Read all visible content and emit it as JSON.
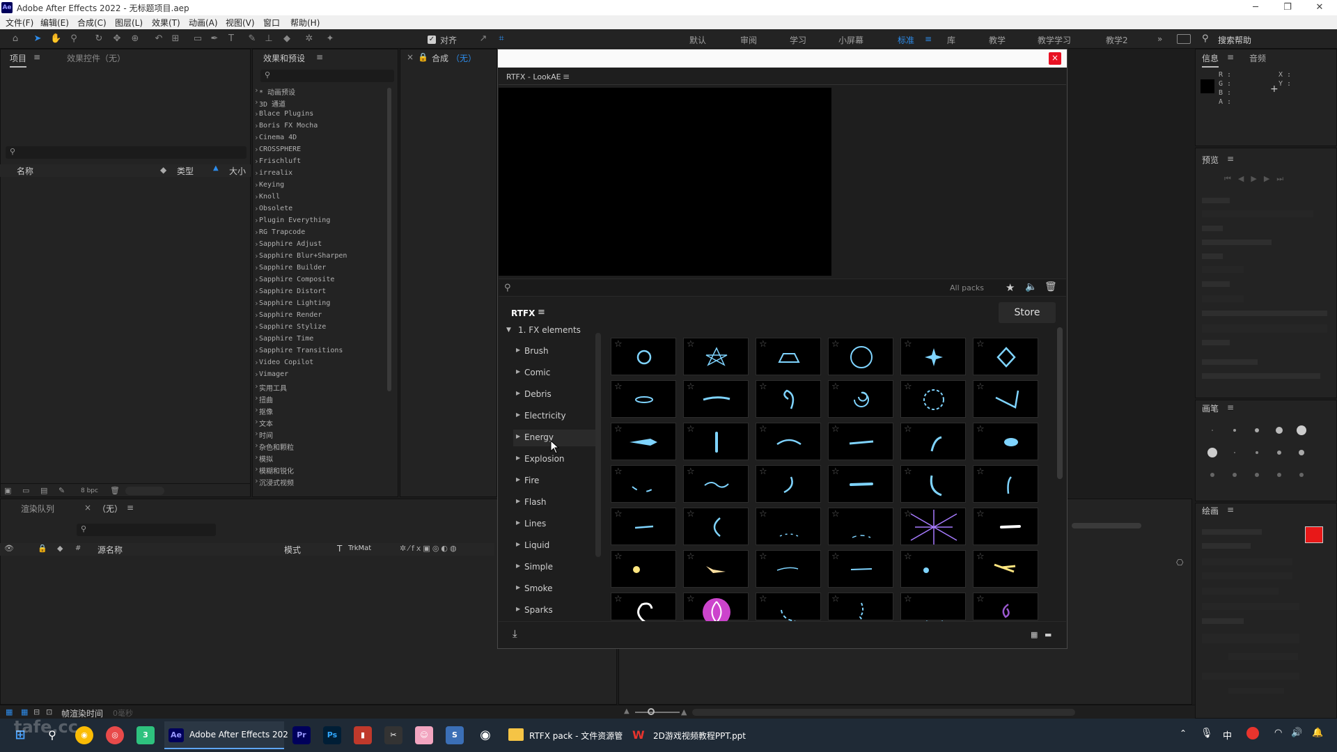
{
  "app": {
    "title": "Adobe After Effects 2022 - 无标题项目.aep",
    "logo": "Ae"
  },
  "menu": [
    "文件(F)",
    "编辑(E)",
    "合成(C)",
    "图层(L)",
    "效果(T)",
    "动画(A)",
    "视图(V)",
    "窗口",
    "帮助(H)"
  ],
  "toolbar": {
    "align_label": "对齐",
    "workspaces": [
      "默认",
      "审阅",
      "学习",
      "小屏幕",
      "标准",
      "库",
      "教学",
      "教学学习",
      "教学2"
    ],
    "active_workspace": "标准",
    "search_help": "搜索帮助"
  },
  "project_panel": {
    "tab_project": "项目",
    "tab_effect_controls": "效果控件（无）",
    "col_name": "名称",
    "col_type": "类型",
    "col_size": "大小",
    "bpc": "8 bpc"
  },
  "effects_panel": {
    "title": "效果和预设",
    "items": [
      "* 动画预设",
      "3D 通道",
      "Blace Plugins",
      "Boris FX Mocha",
      "Cinema 4D",
      "CROSSPHERE",
      "Frischluft",
      "irrealix",
      "Keying",
      "Knoll",
      "Obsolete",
      "Plugin Everything",
      "RG Trapcode",
      "Sapphire Adjust",
      "Sapphire Blur+Sharpen",
      "Sapphire Builder",
      "Sapphire Composite",
      "Sapphire Distort",
      "Sapphire Lighting",
      "Sapphire Render",
      "Sapphire Stylize",
      "Sapphire Time",
      "Sapphire Transitions",
      "Video Copilot",
      "Vimager",
      "实用工具",
      "扭曲",
      "抠像",
      "文本",
      "时间",
      "杂色和颗粒",
      "模拟",
      "模糊和锐化",
      "沉浸式视频"
    ]
  },
  "comp_panel": {
    "tab": "合成",
    "tab_value": "（无）"
  },
  "timeline": {
    "tab_render_queue": "渲染队列",
    "tab_comp": "（无）",
    "col_source": "源名称",
    "col_mode": "模式",
    "col_t": "T",
    "col_trkmat": "TrkMat",
    "footer_label": "帧渲染时间",
    "footer_value": "0毫秒"
  },
  "info_panel": {
    "tab_info": "信息",
    "tab_audio": "音频",
    "channels": [
      "R :",
      "G :",
      "B :",
      "A :"
    ],
    "coords": [
      "X :",
      "Y :"
    ]
  },
  "preview_panel": {
    "title": "预览"
  },
  "brush_panel": {
    "title": "画笔"
  },
  "paint_panel": {
    "title": "绘画"
  },
  "lookae": {
    "window_title": "RTFX - LookAE",
    "search_placeholder": "",
    "all_packs": "All packs",
    "brand": "RTFX",
    "store": "Store",
    "root_category": "1. FX elements",
    "categories": [
      "Brush",
      "Comic",
      "Debris",
      "Electricity",
      "Energy",
      "Explosion",
      "Fire",
      "Flash",
      "Lines",
      "Liquid",
      "Simple",
      "Smoke",
      "Sparks"
    ],
    "hovered_category": "Energy"
  },
  "taskbar": {
    "ae_label": "Adobe After Effects 202",
    "explorer_label": "RTFX pack - 文件资源管",
    "ppt_label": "2D游戏视频教程PPT.ppt",
    "ime": "中",
    "watermark": "tafe.cc"
  },
  "colors": {
    "accent_blue": "#2d8ceb",
    "close_red": "#e81123",
    "fx_glow": "#7fd4ff",
    "paint_fg": "#e81818"
  }
}
